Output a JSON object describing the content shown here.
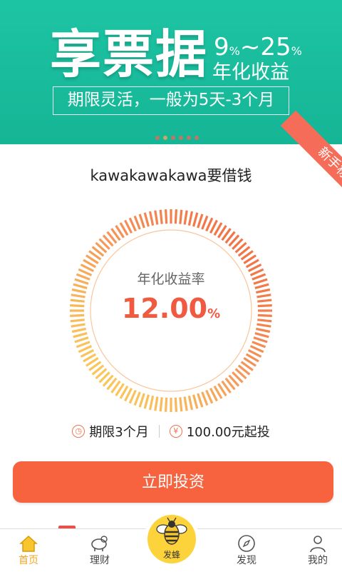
{
  "banner": {
    "title": "享票据",
    "rate_low": "9",
    "rate_high": "25",
    "rate_sep": "~",
    "pct": "%",
    "rate_label": "年化收益",
    "subtitle": "期限灵活，一般为5天-3个月",
    "carousel_total": 6,
    "carousel_active": 1
  },
  "ribbon": {
    "label": "新手标"
  },
  "product": {
    "title": "kawakawakawa要借钱",
    "rate_label": "年化收益率",
    "rate_value": "12.00",
    "rate_unit": "%",
    "term": "期限3个月",
    "min_invest": "100.00元起投",
    "term_icon": "clock-icon",
    "min_icon": "yen-icon",
    "gauge_colors": [
      "#fcd95a",
      "#f59a5a",
      "#f0643f"
    ]
  },
  "actions": {
    "invest_label": "立即投资"
  },
  "nav": {
    "items": [
      {
        "label": "首页",
        "icon": "home-icon",
        "active": true
      },
      {
        "label": "理财",
        "icon": "piggy-bank-icon",
        "active": false
      },
      {
        "label": "发蜂",
        "icon": "bee-icon",
        "active": false
      },
      {
        "label": "发现",
        "icon": "compass-icon",
        "active": false
      },
      {
        "label": "我的",
        "icon": "person-icon",
        "active": false
      }
    ]
  },
  "colors": {
    "banner": "#1dc4a3",
    "accent": "#f8633f",
    "nav_active": "#f2a41e",
    "bee": "#fdd33c"
  }
}
